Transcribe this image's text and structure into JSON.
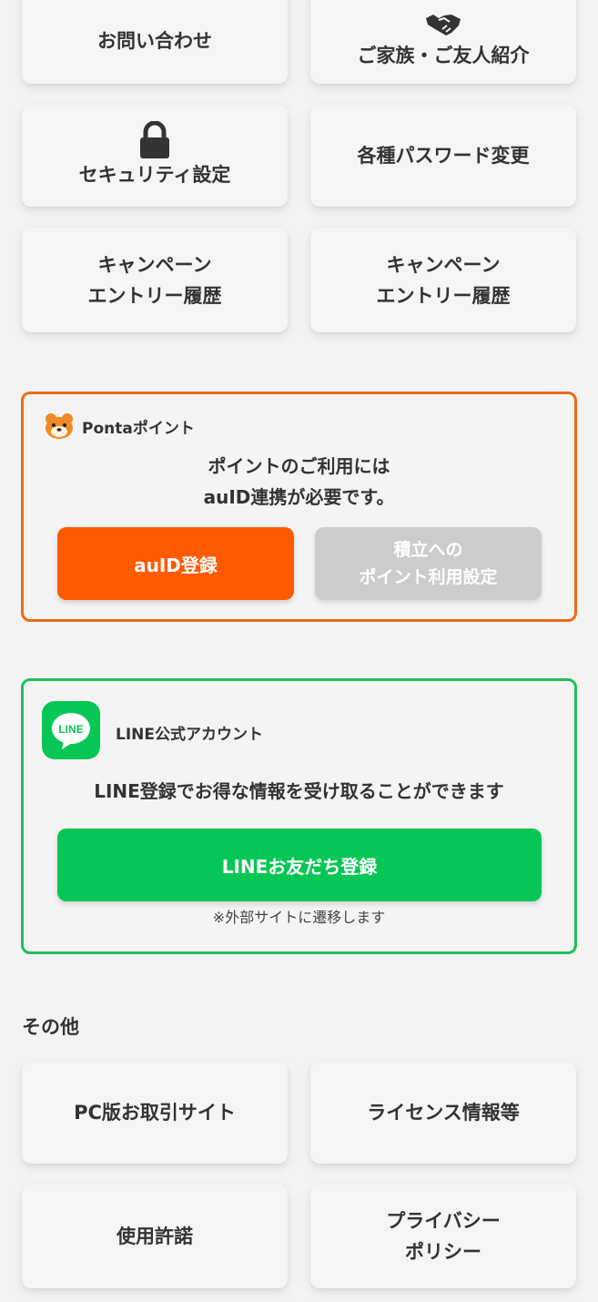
{
  "top_grid": {
    "contact": "お問い合わせ",
    "referral": "ご家族・ご友人紹介",
    "security": "セキュリティ設定",
    "password": "各種パスワード変更",
    "campaign_1": [
      "キャンペーン",
      "エントリー履歴"
    ],
    "campaign_2": [
      "キャンペーン",
      "エントリー履歴"
    ]
  },
  "ponta": {
    "title": "Pontaポイント",
    "message": [
      "ポイントのご利用には",
      "auID連携が必要です。"
    ],
    "register_button": "auID登録",
    "settings_button": [
      "積立への",
      "ポイント利用設定"
    ]
  },
  "line": {
    "icon_text": "LINE",
    "title": "LINE公式アカウント",
    "message": "LINE登録でお得な情報を受け取ることができます",
    "friend_button": "LINEお友だち登録",
    "note": "※外部サイトに遷移します"
  },
  "other": {
    "section_title": "その他",
    "pc_site": "PC版お取引サイト",
    "license": "ライセンス情報等",
    "terms": "使用許諾",
    "privacy": [
      "プライバシー",
      "ポリシー"
    ]
  },
  "colors": {
    "ponta_accent": "#ef6a16",
    "ponta_button": "#ff5a00",
    "disabled_button": "#cccccc",
    "line_green": "#06c755",
    "line_border": "#1fbf5b"
  },
  "icons": [
    "handshake-icon",
    "lock-icon",
    "ponta-logo-icon",
    "line-logo-icon"
  ]
}
